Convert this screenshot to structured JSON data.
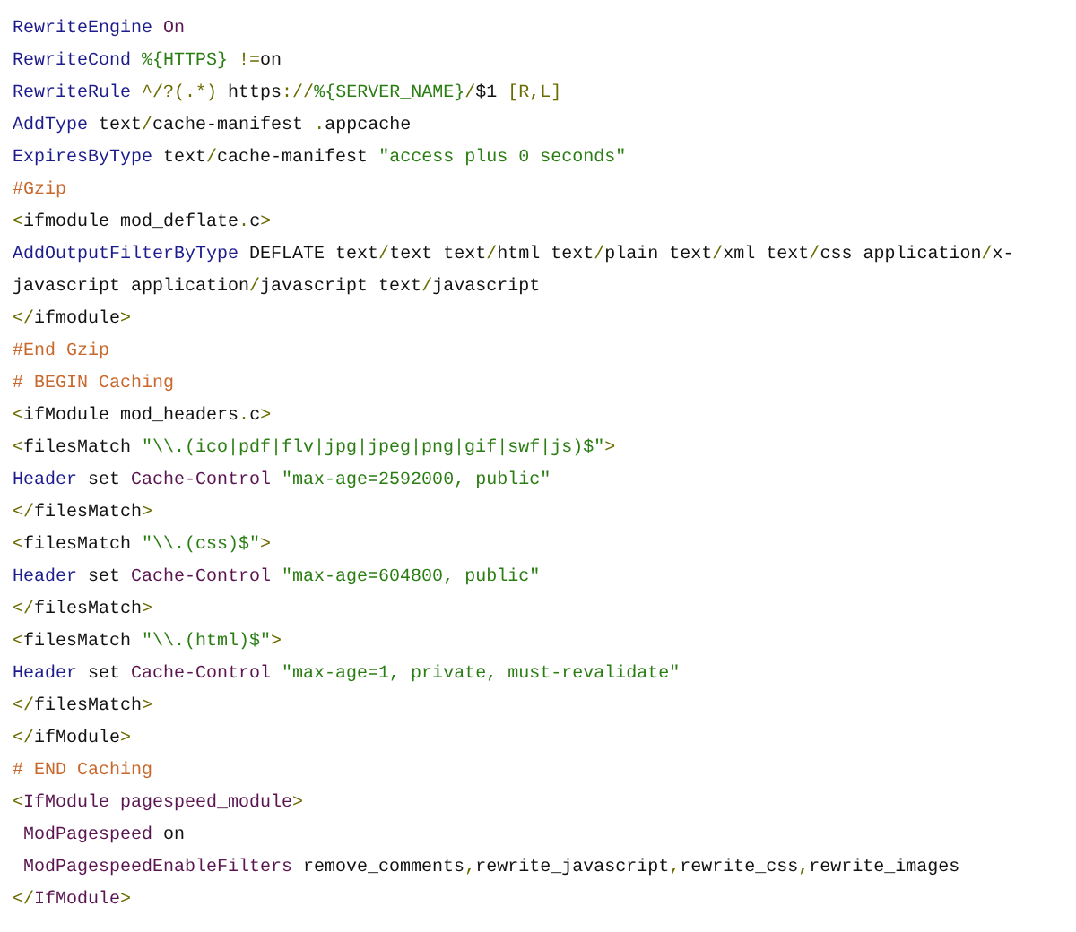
{
  "code_lines": [
    {
      "tokens": [
        {
          "kind": "keyword",
          "text": "RewriteEngine"
        },
        {
          "kind": "value",
          "text": " On"
        }
      ]
    },
    {
      "tokens": [
        {
          "kind": "keyword",
          "text": "RewriteCond"
        },
        {
          "kind": "string",
          "text": " %{HTTPS}"
        },
        {
          "kind": "punct",
          "text": " !="
        },
        {
          "kind": "plain",
          "text": "on"
        }
      ]
    },
    {
      "tokens": [
        {
          "kind": "keyword",
          "text": "RewriteRule"
        },
        {
          "kind": "punct",
          "text": " ^/?(.*)"
        },
        {
          "kind": "plain",
          "text": " https"
        },
        {
          "kind": "punct",
          "text": "://"
        },
        {
          "kind": "string",
          "text": "%{SERVER_NAME}"
        },
        {
          "kind": "punct",
          "text": "/"
        },
        {
          "kind": "plain",
          "text": "$1 "
        },
        {
          "kind": "punct",
          "text": "[R,L]"
        }
      ]
    },
    {
      "tokens": [
        {
          "kind": "keyword",
          "text": "AddType"
        },
        {
          "kind": "plain",
          "text": " text"
        },
        {
          "kind": "punct",
          "text": "/"
        },
        {
          "kind": "plain",
          "text": "cache-manifest "
        },
        {
          "kind": "punct",
          "text": "."
        },
        {
          "kind": "plain",
          "text": "appcache"
        }
      ]
    },
    {
      "tokens": [
        {
          "kind": "keyword",
          "text": "ExpiresByType"
        },
        {
          "kind": "plain",
          "text": " text"
        },
        {
          "kind": "punct",
          "text": "/"
        },
        {
          "kind": "plain",
          "text": "cache-manifest "
        },
        {
          "kind": "string",
          "text": "\"access plus 0 seconds\""
        }
      ]
    },
    {
      "tokens": [
        {
          "kind": "comment",
          "text": "#Gzip"
        }
      ]
    },
    {
      "tokens": [
        {
          "kind": "punct",
          "text": "<"
        },
        {
          "kind": "plain",
          "text": "ifmodule mod_deflate"
        },
        {
          "kind": "punct",
          "text": "."
        },
        {
          "kind": "plain",
          "text": "c"
        },
        {
          "kind": "punct",
          "text": ">"
        }
      ]
    },
    {
      "tokens": [
        {
          "kind": "keyword",
          "text": "AddOutputFilterByType"
        },
        {
          "kind": "plain",
          "text": " DEFLATE text"
        },
        {
          "kind": "punct",
          "text": "/"
        },
        {
          "kind": "plain",
          "text": "text text"
        },
        {
          "kind": "punct",
          "text": "/"
        },
        {
          "kind": "plain",
          "text": "html text"
        },
        {
          "kind": "punct",
          "text": "/"
        },
        {
          "kind": "plain",
          "text": "plain text"
        },
        {
          "kind": "punct",
          "text": "/"
        },
        {
          "kind": "plain",
          "text": "xml text"
        },
        {
          "kind": "punct",
          "text": "/"
        },
        {
          "kind": "plain",
          "text": "css application"
        },
        {
          "kind": "punct",
          "text": "/"
        },
        {
          "kind": "plain",
          "text": "x-javascript application"
        },
        {
          "kind": "punct",
          "text": "/"
        },
        {
          "kind": "plain",
          "text": "javascript text"
        },
        {
          "kind": "punct",
          "text": "/"
        },
        {
          "kind": "plain",
          "text": "javascript"
        }
      ]
    },
    {
      "tokens": [
        {
          "kind": "punct",
          "text": "</"
        },
        {
          "kind": "plain",
          "text": "ifmodule"
        },
        {
          "kind": "punct",
          "text": ">"
        }
      ]
    },
    {
      "tokens": [
        {
          "kind": "comment",
          "text": "#End Gzip"
        }
      ]
    },
    {
      "tokens": [
        {
          "kind": "comment",
          "text": "# BEGIN Caching"
        }
      ]
    },
    {
      "tokens": [
        {
          "kind": "punct",
          "text": "<"
        },
        {
          "kind": "plain",
          "text": "ifModule mod_headers"
        },
        {
          "kind": "punct",
          "text": "."
        },
        {
          "kind": "plain",
          "text": "c"
        },
        {
          "kind": "punct",
          "text": ">"
        }
      ]
    },
    {
      "tokens": [
        {
          "kind": "punct",
          "text": "<"
        },
        {
          "kind": "plain",
          "text": "filesMatch "
        },
        {
          "kind": "string",
          "text": "\"\\\\.(ico|pdf|flv|jpg|jpeg|png|gif|swf|js)$\""
        },
        {
          "kind": "punct",
          "text": ">"
        }
      ]
    },
    {
      "tokens": [
        {
          "kind": "keyword",
          "text": "Header"
        },
        {
          "kind": "plain",
          "text": " set "
        },
        {
          "kind": "value",
          "text": "Cache-Control"
        },
        {
          "kind": "string",
          "text": " \"max-age=2592000, public\""
        }
      ]
    },
    {
      "tokens": [
        {
          "kind": "punct",
          "text": "</"
        },
        {
          "kind": "plain",
          "text": "filesMatch"
        },
        {
          "kind": "punct",
          "text": ">"
        }
      ]
    },
    {
      "tokens": [
        {
          "kind": "punct",
          "text": "<"
        },
        {
          "kind": "plain",
          "text": "filesMatch "
        },
        {
          "kind": "string",
          "text": "\"\\\\.(css)$\""
        },
        {
          "kind": "punct",
          "text": ">"
        }
      ]
    },
    {
      "tokens": [
        {
          "kind": "keyword",
          "text": "Header"
        },
        {
          "kind": "plain",
          "text": " set "
        },
        {
          "kind": "value",
          "text": "Cache-Control"
        },
        {
          "kind": "string",
          "text": " \"max-age=604800, public\""
        }
      ]
    },
    {
      "tokens": [
        {
          "kind": "punct",
          "text": "</"
        },
        {
          "kind": "plain",
          "text": "filesMatch"
        },
        {
          "kind": "punct",
          "text": ">"
        }
      ]
    },
    {
      "tokens": [
        {
          "kind": "punct",
          "text": "<"
        },
        {
          "kind": "plain",
          "text": "filesMatch "
        },
        {
          "kind": "string",
          "text": "\"\\\\.(html)$\""
        },
        {
          "kind": "punct",
          "text": ">"
        }
      ]
    },
    {
      "tokens": [
        {
          "kind": "keyword",
          "text": "Header"
        },
        {
          "kind": "plain",
          "text": " set "
        },
        {
          "kind": "value",
          "text": "Cache-Control"
        },
        {
          "kind": "string",
          "text": " \"max-age=1, private, must-revalidate\""
        }
      ]
    },
    {
      "tokens": [
        {
          "kind": "punct",
          "text": "</"
        },
        {
          "kind": "plain",
          "text": "filesMatch"
        },
        {
          "kind": "punct",
          "text": ">"
        }
      ]
    },
    {
      "tokens": [
        {
          "kind": "punct",
          "text": "</"
        },
        {
          "kind": "plain",
          "text": "ifModule"
        },
        {
          "kind": "punct",
          "text": ">"
        }
      ]
    },
    {
      "tokens": [
        {
          "kind": "comment",
          "text": "# END Caching"
        }
      ]
    },
    {
      "tokens": [
        {
          "kind": "punct",
          "text": "<"
        },
        {
          "kind": "value",
          "text": "IfModule pagespeed_module"
        },
        {
          "kind": "punct",
          "text": ">"
        }
      ]
    },
    {
      "tokens": [
        {
          "kind": "value",
          "text": " ModPagespeed"
        },
        {
          "kind": "plain",
          "text": " on"
        }
      ]
    },
    {
      "tokens": [
        {
          "kind": "value",
          "text": " ModPagespeedEnableFilters"
        },
        {
          "kind": "plain",
          "text": " remove_comments"
        },
        {
          "kind": "punct",
          "text": ","
        },
        {
          "kind": "plain",
          "text": "rewrite_javascript"
        },
        {
          "kind": "punct",
          "text": ","
        },
        {
          "kind": "plain",
          "text": "rewrite_css"
        },
        {
          "kind": "punct",
          "text": ","
        },
        {
          "kind": "plain",
          "text": "rewrite_images"
        }
      ]
    },
    {
      "tokens": [
        {
          "kind": "punct",
          "text": "</"
        },
        {
          "kind": "value",
          "text": "IfModule"
        },
        {
          "kind": "punct",
          "text": ">"
        }
      ]
    }
  ]
}
